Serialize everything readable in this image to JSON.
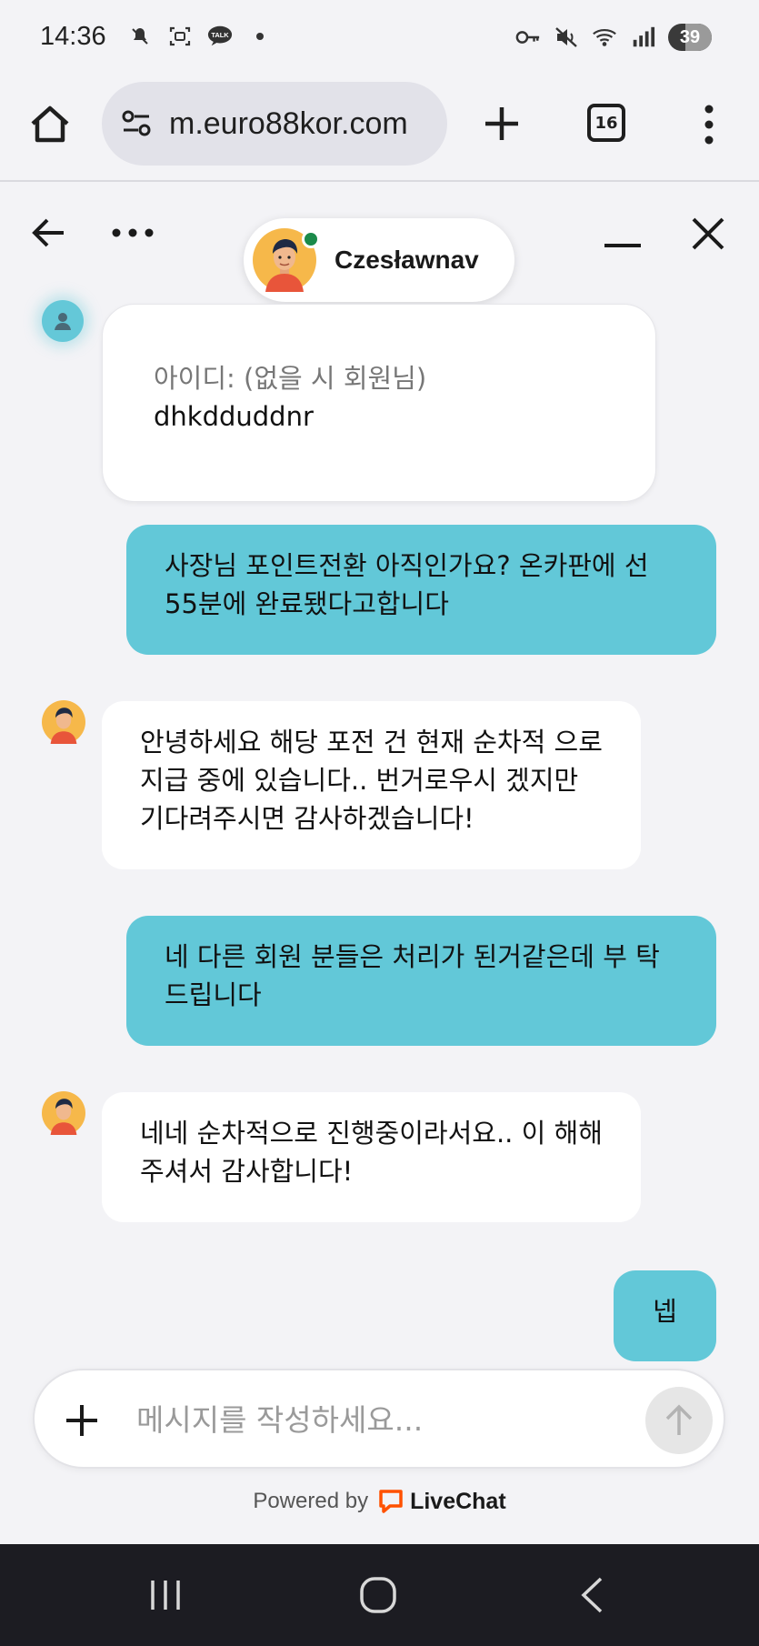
{
  "status_bar": {
    "time": "14:36",
    "battery": "39",
    "left_icons": [
      "mute-icon",
      "screenshot-icon",
      "talk-icon",
      "dot-icon"
    ],
    "right_icons": [
      "key-icon",
      "vibrate-icon",
      "wifi-icon",
      "signal-icon"
    ]
  },
  "browser": {
    "url": "m.euro88kor.com",
    "tab_count": "16"
  },
  "chat_header": {
    "agent_name": "Czesławnav"
  },
  "messages": [
    {
      "from": "visitor-form",
      "label": "아이디: (없을 시 회원님)",
      "value": "dhkdduddnr"
    },
    {
      "from": "visitor",
      "text": "사장님 포인트전환 아직인가요? 온카판에 선 55분에 완료됐다고합니다"
    },
    {
      "from": "agent",
      "text": "안녕하세요 해당 포전 건 현재 순차적 으로 지급 중에 있습니다.. 번거로우시 겠지만 기다려주시면 감사하겠습니다!"
    },
    {
      "from": "visitor",
      "text": "네 다른 회원 분들은 처리가 된거같은데 부 탁드립니다"
    },
    {
      "from": "agent",
      "text": "네네 순차적으로 진행중이라서요.. 이 해해주셔서 감사합니다!"
    },
    {
      "from": "visitor",
      "text": "넵"
    }
  ],
  "composer": {
    "placeholder": "메시지를 작성하세요..."
  },
  "footer": {
    "powered_by": "Powered by",
    "brand": "LiveChat",
    "brand_color": "#ff5100"
  },
  "colors": {
    "visitor_bubble": "#62c8d8",
    "agent_bubble": "#ffffff",
    "background": "#f3f3f6"
  }
}
